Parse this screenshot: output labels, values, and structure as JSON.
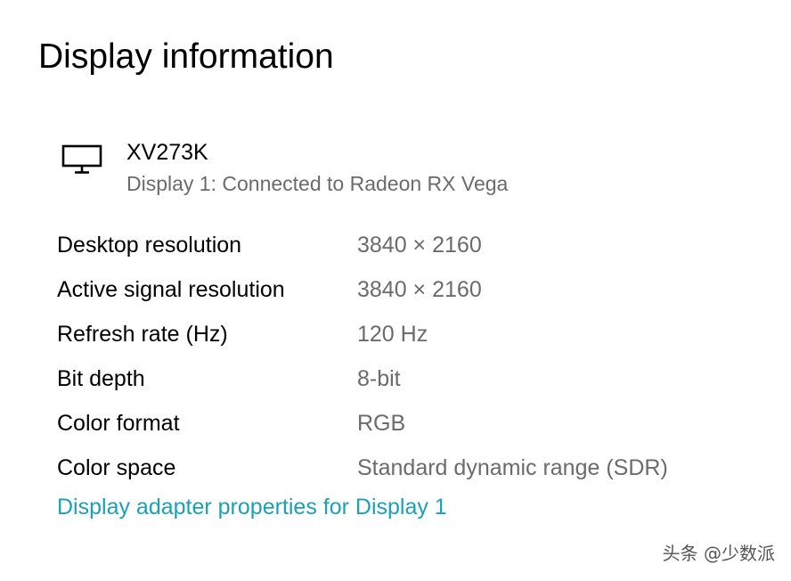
{
  "page": {
    "title": "Display information"
  },
  "display": {
    "icon": "monitor-icon",
    "name": "XV273K",
    "subtitle": "Display 1: Connected to Radeon RX Vega"
  },
  "info": [
    {
      "label": "Desktop resolution",
      "value": "3840 × 2160"
    },
    {
      "label": "Active signal resolution",
      "value": "3840 × 2160"
    },
    {
      "label": "Refresh rate (Hz)",
      "value": "120 Hz"
    },
    {
      "label": "Bit depth",
      "value": "8-bit"
    },
    {
      "label": "Color format",
      "value": "RGB"
    },
    {
      "label": "Color space",
      "value": "Standard dynamic range (SDR)"
    }
  ],
  "links": {
    "adapter_properties": "Display adapter properties for Display 1"
  },
  "watermark": "头条 @少数派",
  "colors": {
    "link": "#1ba1b5",
    "secondary_text": "#6b6b6b"
  }
}
